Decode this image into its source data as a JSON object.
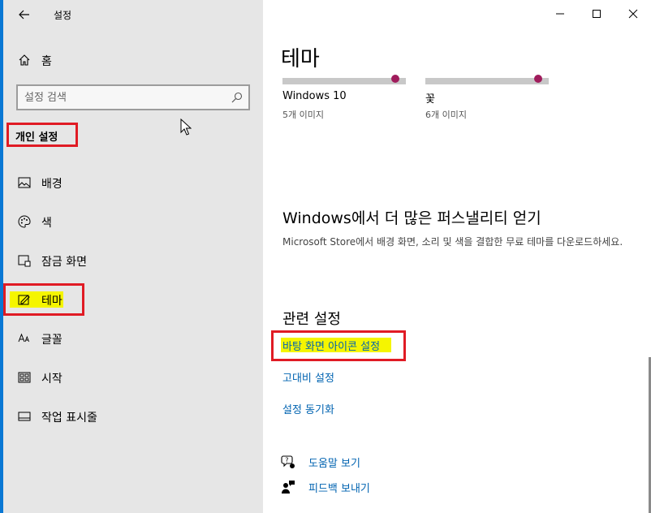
{
  "app": {
    "title": "설정"
  },
  "sidebar": {
    "home_label": "홈",
    "search_placeholder": "설정 검색",
    "section_label": "개인 설정",
    "items": [
      {
        "label": "배경",
        "icon": "picture-icon"
      },
      {
        "label": "색",
        "icon": "palette-icon"
      },
      {
        "label": "잠금 화면",
        "icon": "lock-screen-icon"
      },
      {
        "label": "테마",
        "icon": "theme-icon"
      },
      {
        "label": "글꼴",
        "icon": "font-icon"
      },
      {
        "label": "시작",
        "icon": "start-icon"
      },
      {
        "label": "작업 표시줄",
        "icon": "taskbar-icon"
      }
    ],
    "selected_index": 3
  },
  "content": {
    "page_title": "테마",
    "themes": [
      {
        "name": "Windows 10",
        "count": "5개 이미지"
      },
      {
        "name": "꽃",
        "count": "6개 이미지"
      }
    ],
    "more": {
      "title": "Windows에서 더 많은 퍼스낼리티 얻기",
      "description": "Microsoft Store에서 배경 화면, 소리 및 색을 결합한 무료 테마를 다운로드하세요."
    },
    "related": {
      "title": "관련 설정",
      "links": [
        "바탕 화면 아이콘 설정",
        "고대비 설정",
        "설정 동기화"
      ]
    },
    "help": [
      {
        "label": "도움말 보기",
        "icon": "help-icon"
      },
      {
        "label": "피드백 보내기",
        "icon": "feedback-icon"
      }
    ]
  },
  "colors": {
    "accent": "#0a78d4",
    "link": "#0063b1",
    "highlight_box": "#e01b24",
    "marker": "#f5f500"
  }
}
